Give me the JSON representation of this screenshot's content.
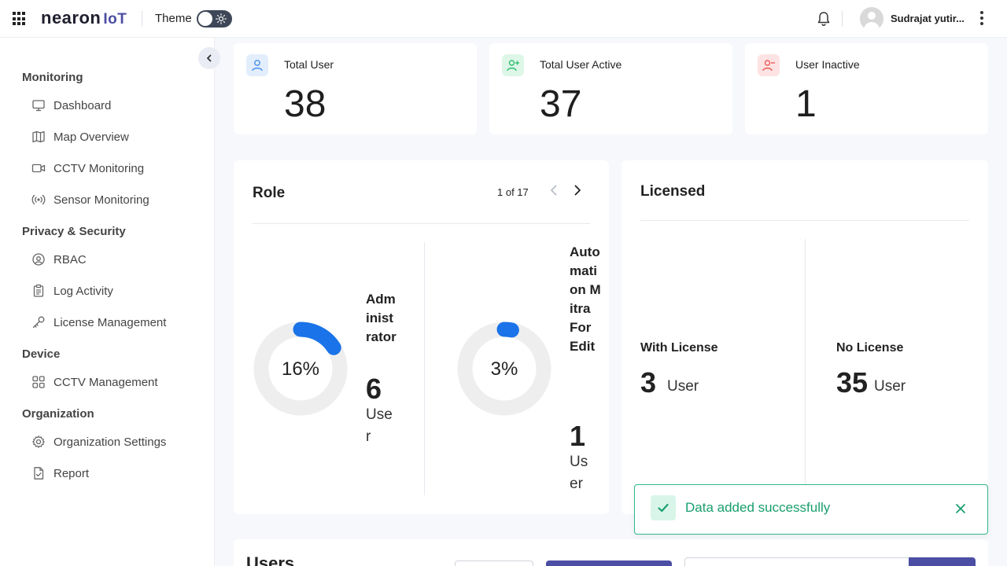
{
  "header": {
    "logo_main": "nearon",
    "logo_suffix": "IoT",
    "theme_label": "Theme",
    "user_name": "Sudrajat yutir..."
  },
  "sidebar": {
    "sections": [
      {
        "title": "Monitoring",
        "items": [
          "Dashboard",
          "Map Overview",
          "CCTV Monitoring",
          "Sensor Monitoring"
        ]
      },
      {
        "title": "Privacy & Security",
        "items": [
          "RBAC",
          "Log Activity",
          "License Management"
        ]
      },
      {
        "title": "Device",
        "items": [
          "CCTV Management"
        ]
      },
      {
        "title": "Organization",
        "items": [
          "Organization Settings",
          "Report"
        ]
      }
    ]
  },
  "stats": [
    {
      "label": "Total User",
      "value": "38",
      "icon": "user-icon",
      "color": "#4a8ef0",
      "bg": "#e3eefc"
    },
    {
      "label": "Total User Active",
      "value": "37",
      "icon": "user-plus-icon",
      "color": "#2fbf71",
      "bg": "#def6e8"
    },
    {
      "label": "User Inactive",
      "value": "1",
      "icon": "user-minus-icon",
      "color": "#ef5a5a",
      "bg": "#fde3e3"
    }
  ],
  "role": {
    "title": "Role",
    "pager": "1 of 17",
    "items": [
      {
        "percent_label": "16%",
        "percent": 16,
        "name": "Administrator",
        "count": "6",
        "unit": "User"
      },
      {
        "percent_label": "3%",
        "percent": 3,
        "name": "Automation Mitra For Edit",
        "count": "1",
        "unit": "User"
      }
    ]
  },
  "licensed": {
    "title": "Licensed",
    "with_label": "With License",
    "with_value": "3",
    "with_unit": "User",
    "no_label": "No License",
    "no_value": "35",
    "no_unit": "User"
  },
  "users": {
    "title": "Users"
  },
  "toast": {
    "message": "Data added successfully"
  },
  "colors": {
    "accent": "#4b4ea3",
    "donut": "#1a73e8",
    "success": "#1a9f6f"
  }
}
